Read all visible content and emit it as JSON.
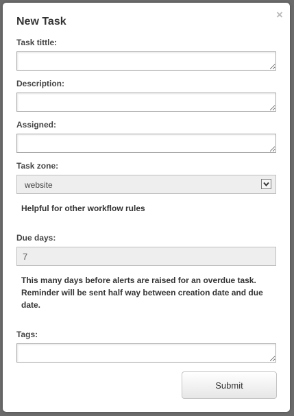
{
  "dialog": {
    "title": "New Task",
    "close_label": "×"
  },
  "fields": {
    "task_title": {
      "label": "Task tittle:",
      "value": ""
    },
    "description": {
      "label": "Description:",
      "value": ""
    },
    "assigned": {
      "label": "Assigned:",
      "value": ""
    },
    "task_zone": {
      "label": "Task zone:",
      "selected": "website",
      "help": "Helpful for other workflow rules"
    },
    "due_days": {
      "label": "Due days:",
      "value": "7",
      "help": "This many days before alerts are raised for an overdue task. Reminder will be sent half way between creation date and due date."
    },
    "tags": {
      "label": "Tags:",
      "value": ""
    }
  },
  "actions": {
    "submit_label": "Submit"
  },
  "icons": {
    "close": "close-icon",
    "dropdown": "chevron-down-icon"
  }
}
